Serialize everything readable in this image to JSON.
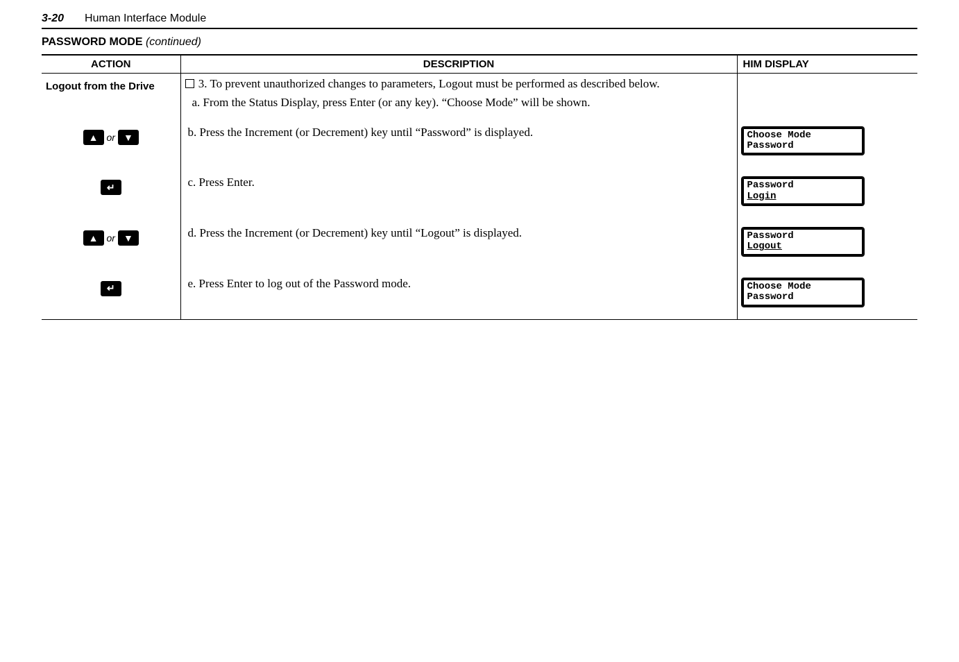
{
  "header": {
    "page_num": "3-20",
    "title": "Human Interface Module"
  },
  "section": {
    "name": "PASSWORD MODE",
    "suffix": "(continued)"
  },
  "table": {
    "headers": {
      "action": "ACTION",
      "description": "DESCRIPTION",
      "him": "HIM DISPLAY"
    },
    "action_main": "Logout from the Drive",
    "step_number": "3.",
    "step_text": "To prevent unauthorized changes to parameters, Logout must be performed as described below.",
    "sub_a": "a.  From the Status Display, press Enter (or any key). “Choose Mode” will be shown.",
    "sub_b": "b.  Press the Increment (or Decrement) key until “Password” is displayed.",
    "sub_c": "c.  Press Enter.",
    "sub_d": "d.  Press the Increment (or Decrement) key until “Logout” is displayed.",
    "sub_e": "e.  Press Enter to log out of the Password mode.",
    "or": "or",
    "him_b": {
      "l1": "Choose Mode",
      "l2": "Password"
    },
    "him_c": {
      "l1": "Password",
      "l2": "Login"
    },
    "him_d": {
      "l1": "Password",
      "l2": "Logout"
    },
    "him_e": {
      "l1": "Choose Mode",
      "l2": "Password"
    }
  }
}
